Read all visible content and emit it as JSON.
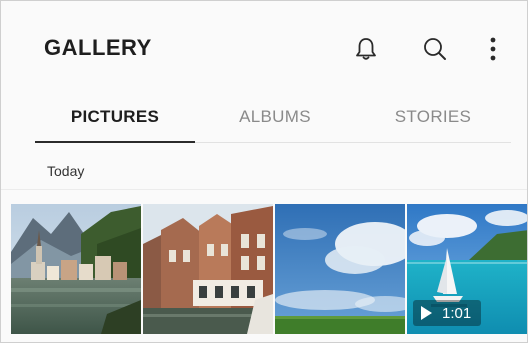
{
  "header": {
    "title": "GALLERY",
    "icons": [
      "bell-icon",
      "search-icon",
      "more-vertical-icon"
    ]
  },
  "tabs": [
    {
      "label": "PICTURES",
      "active": true
    },
    {
      "label": "ALBUMS",
      "active": false
    },
    {
      "label": "STORIES",
      "active": false
    }
  ],
  "section": {
    "label": "Today"
  },
  "thumbnails": [
    {
      "subject": "lakeside village with mountains"
    },
    {
      "subject": "brick canal houses"
    },
    {
      "subject": "blue sky with clouds over field"
    },
    {
      "subject": "sailboat on turquoise sea",
      "video_duration": "1:01"
    }
  ],
  "colors": {
    "background": "#fafafa",
    "active_tab": "#1e1e1e",
    "inactive_tab": "#8a8a8a"
  }
}
